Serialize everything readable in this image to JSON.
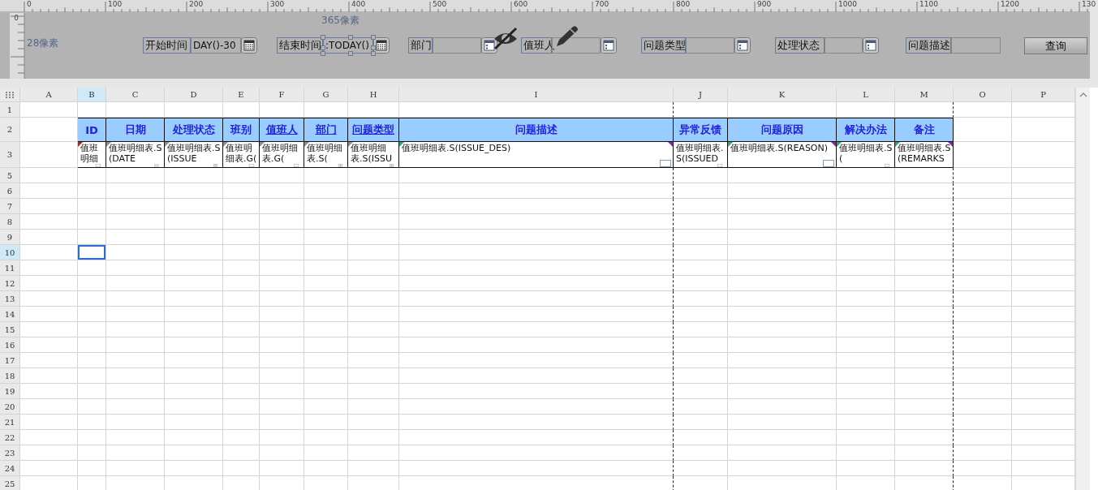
{
  "ruler": {
    "top_labels": [
      "0",
      "100",
      "200",
      "300",
      "400",
      "500",
      "600",
      "700",
      "800",
      "900",
      "1000",
      "1100",
      "1200",
      "130"
    ],
    "left_labels": [
      "0"
    ]
  },
  "designer": {
    "width_note": "365像素",
    "height_note": "28像素",
    "params": [
      {
        "label": "开始时间",
        "value": "DAY()-30",
        "kind": "date",
        "selected": false,
        "hidden": false
      },
      {
        "label": "结束时间",
        "value": ":TODAY()",
        "kind": "date",
        "selected": true,
        "hidden": false
      },
      {
        "label": "部门",
        "kind": "dropdown",
        "selected": false,
        "hidden": false
      },
      {
        "label": "值班人",
        "kind": "dropdown",
        "selected": false,
        "hidden": true
      },
      {
        "label": "问题类型",
        "kind": "dropdown",
        "selected": false,
        "hidden": false
      },
      {
        "label": "处理状态",
        "kind": "dropdown",
        "selected": false,
        "hidden": false
      },
      {
        "label": "问题描述",
        "kind": "text",
        "selected": false,
        "hidden": false
      }
    ],
    "query_button": "查询"
  },
  "sheet": {
    "columns": [
      {
        "letter": "A",
        "selected": false
      },
      {
        "letter": "B",
        "selected": true
      },
      {
        "letter": "C",
        "selected": false
      },
      {
        "letter": "D",
        "selected": false
      },
      {
        "letter": "E",
        "selected": false
      },
      {
        "letter": "F",
        "selected": false
      },
      {
        "letter": "G",
        "selected": false
      },
      {
        "letter": "H",
        "selected": false
      },
      {
        "letter": "I",
        "selected": false
      },
      {
        "letter": "J",
        "selected": false
      },
      {
        "letter": "K",
        "selected": false
      },
      {
        "letter": "L",
        "selected": false
      },
      {
        "letter": "M",
        "selected": false
      },
      {
        "letter": "O",
        "selected": false
      },
      {
        "letter": "P",
        "selected": false
      }
    ],
    "rows": [
      {
        "number": "1",
        "selected": false
      },
      {
        "number": "2",
        "selected": false
      },
      {
        "number": "3",
        "selected": false
      },
      {
        "number": "5",
        "selected": false
      },
      {
        "number": "6",
        "selected": false
      },
      {
        "number": "7",
        "selected": false
      },
      {
        "number": "8",
        "selected": false
      },
      {
        "number": "9",
        "selected": false
      },
      {
        "number": "10",
        "selected": true
      },
      {
        "number": "11",
        "selected": false
      },
      {
        "number": "12",
        "selected": false
      },
      {
        "number": "13",
        "selected": false
      },
      {
        "number": "14",
        "selected": false
      },
      {
        "number": "15",
        "selected": false
      },
      {
        "number": "16",
        "selected": false
      },
      {
        "number": "17",
        "selected": false
      },
      {
        "number": "18",
        "selected": false
      },
      {
        "number": "19",
        "selected": false
      },
      {
        "number": "20",
        "selected": false
      },
      {
        "number": "21",
        "selected": false
      },
      {
        "number": "22",
        "selected": false
      },
      {
        "number": "23",
        "selected": false
      },
      {
        "number": "24",
        "selected": false
      },
      {
        "number": "25",
        "selected": false
      }
    ],
    "headers": [
      {
        "text": "ID",
        "underlined": false
      },
      {
        "text": "日期",
        "underlined": false
      },
      {
        "text": "处理状态",
        "underlined": false
      },
      {
        "text": "班别",
        "underlined": false
      },
      {
        "text": "值班人",
        "underlined": true
      },
      {
        "text": "部门",
        "underlined": true
      },
      {
        "text": "问题类型",
        "underlined": true
      },
      {
        "text": "问题描述",
        "underlined": false
      },
      {
        "text": "异常反馈",
        "underlined": false
      },
      {
        "text": "问题原因",
        "underlined": false
      },
      {
        "text": "解决办法",
        "underlined": false
      },
      {
        "text": "备注",
        "underlined": false
      }
    ],
    "data": [
      {
        "text": "值班明细",
        "kind": "text",
        "corner_marks": [
          {
            "kind": "left",
            "color": "#a02828"
          }
        ]
      },
      {
        "text": "值班明细表.S(DATE",
        "kind": "date",
        "corner_marks": [
          {
            "kind": "left",
            "color": "#909090"
          }
        ]
      },
      {
        "text": "值班明细表.S(ISSUE",
        "kind": "dropdown",
        "corner_marks": [
          {
            "kind": "left",
            "color": "#909090"
          }
        ]
      },
      {
        "text": "值班明细表.G(",
        "kind": "text",
        "corner_marks": [
          {
            "kind": "left",
            "color": "#909090"
          }
        ]
      },
      {
        "text": "值班明细表.G(",
        "kind": "text",
        "corner_marks": [
          {
            "kind": "left",
            "color": "#909090"
          }
        ]
      },
      {
        "text": "值班明细表.S(",
        "kind": "dropdown",
        "corner_marks": [
          {
            "kind": "left",
            "color": "#909090"
          }
        ]
      },
      {
        "text": "值班明细表.S(ISSU",
        "kind": "dropdown",
        "corner_marks": [
          {
            "kind": "left",
            "color": "#909090"
          }
        ]
      },
      {
        "text": "值班明细表.S(ISSUE_DES)",
        "kind": "text",
        "corner_marks": [
          {
            "kind": "left",
            "color": "#2aa87a"
          },
          {
            "kind": "right",
            "color": "#9020b0"
          }
        ]
      },
      {
        "text": "值班明细表.S(ISSUED",
        "kind": "text"
      },
      {
        "text": "值班明细表.S(REASON)",
        "kind": "text",
        "corner_marks": [
          {
            "kind": "left",
            "color": "#2aa87a"
          },
          {
            "kind": "right",
            "color": "#9020b0"
          }
        ]
      },
      {
        "text": "值班明细表.S(",
        "kind": "text",
        "corner_marks": [
          {
            "kind": "left",
            "color": "#2aa87a"
          }
        ]
      },
      {
        "text": "值班明细表.S(REMARKS",
        "kind": "none",
        "corner_marks": [
          {
            "kind": "left",
            "color": "#2aa87a"
          },
          {
            "kind": "right",
            "color": "#9020b0"
          }
        ]
      }
    ]
  }
}
